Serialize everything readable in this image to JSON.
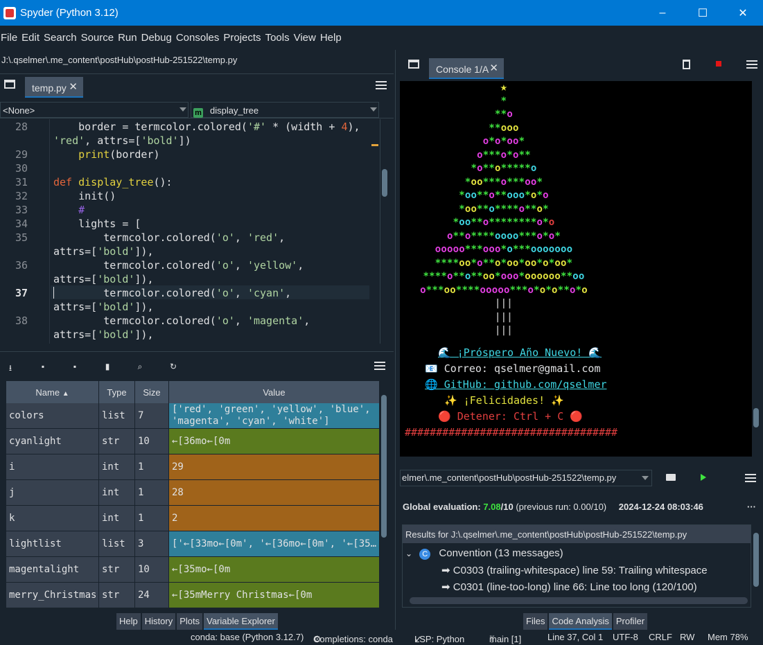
{
  "window": {
    "title": "Spyder (Python 3.12)",
    "controls": [
      "–",
      "☐",
      "✕"
    ]
  },
  "menu": [
    "File",
    "Edit",
    "Search",
    "Source",
    "Run",
    "Debug",
    "Consoles",
    "Projects",
    "Tools",
    "View",
    "Help"
  ],
  "path": "J:\\.qselmer\\.me_content\\postHub\\postHub-251522\\temp.py",
  "editor": {
    "tab": "temp.py",
    "class_selector": "<None>",
    "function_selector": "display_tree",
    "function_badge": "m",
    "current_line": 37
  },
  "variable_explorer": {
    "columns": [
      "Name",
      "Type",
      "Size",
      "Value"
    ],
    "rows": [
      {
        "name": "colors",
        "type": "list",
        "size": "7",
        "value": "['red', 'green', 'yellow', 'blue',\n'magenta', 'cyan', 'white']",
        "color": "#2f7f9a"
      },
      {
        "name": "cyanlight",
        "type": "str",
        "size": "10",
        "value": "←[36mo←[0m",
        "color": "#5a7a1e"
      },
      {
        "name": "i",
        "type": "int",
        "size": "1",
        "value": "29",
        "color": "#a0631a"
      },
      {
        "name": "j",
        "type": "int",
        "size": "1",
        "value": "28",
        "color": "#a0631a"
      },
      {
        "name": "k",
        "type": "int",
        "size": "1",
        "value": "2",
        "color": "#a0631a"
      },
      {
        "name": "lightlist",
        "type": "list",
        "size": "3",
        "value": "['←[33mo←[0m', '←[36mo←[0m', '←[35…",
        "color": "#2f7f9a"
      },
      {
        "name": "magentalight",
        "type": "str",
        "size": "10",
        "value": "←[35mo←[0m",
        "color": "#5a7a1e"
      },
      {
        "name": "merry_Christmas",
        "type": "str",
        "size": "24",
        "value": "←[35mMerry Christmas←[0m",
        "color": "#5a7a1e"
      }
    ]
  },
  "left_bottom_tabs": [
    "Help",
    "History",
    "Plots",
    "Variable Explorer"
  ],
  "console": {
    "tab": "Console 1/A",
    "greeting": "🌊 ¡Próspero Año Nuevo! 🌊",
    "email": "📧 Correo: qselmer@gmail.com",
    "github": "🌐 GitHub: github.com/qselmer",
    "congrats": "✨ ¡Felicidades! ✨",
    "stop": "🔴 Detener: Ctrl + C 🔴",
    "border": "##################################"
  },
  "code_analysis": {
    "file": "elmer\\.me_content\\postHub\\postHub-251522\\temp.py",
    "global_eval_label": "Global evaluation:",
    "score": "7.08",
    "score_max": "/10",
    "previous": "(previous run: 0.00/10)",
    "timestamp": "2024-12-24 08:03:46",
    "results_for": "Results for J:\\.qselmer\\.me_content\\postHub\\postHub-251522\\temp.py",
    "category": "Convention (13 messages)",
    "messages": [
      "C0303 (trailing-whitespace) line 59:  Trailing whitespace",
      "C0301 (line-too-long) line 66:  Line too long (120/100)"
    ]
  },
  "right_bottom_tabs": [
    "Files",
    "Code Analysis",
    "Profiler"
  ],
  "status": {
    "env": "conda: base (Python 3.12.7)",
    "completions": "Completions: conda",
    "lsp": "LSP: Python",
    "branch": "main [1]",
    "position": "Line 37, Col 1",
    "encoding": "UTF-8",
    "eol": "CRLF",
    "perm": "RW",
    "mem": "Mem 78%"
  }
}
